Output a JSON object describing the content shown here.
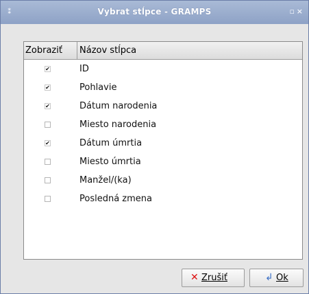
{
  "window": {
    "title": "Vybrat stĺpce - GRAMPS"
  },
  "table": {
    "headers": [
      "Zobraziť",
      "Názov stĺpca"
    ],
    "rows": [
      {
        "label": "ID",
        "checked": true
      },
      {
        "label": "Pohlavie",
        "checked": true
      },
      {
        "label": "Dátum narodenia",
        "checked": true
      },
      {
        "label": "Miesto narodenia",
        "checked": false
      },
      {
        "label": "Dátum úmrtia",
        "checked": true
      },
      {
        "label": "Miesto úmrtia",
        "checked": false
      },
      {
        "label": "Manžel/(ka)",
        "checked": false
      },
      {
        "label": "Posledná zmena",
        "checked": false
      }
    ]
  },
  "buttons": {
    "cancel": "Zrušiť",
    "ok": "Ok"
  },
  "icons": {
    "menu": "window-menu-icon",
    "restore": "restore-icon",
    "close": "close-icon",
    "cancel": "cancel-x-icon",
    "ok": "ok-arrow-icon"
  },
  "colors": {
    "titlebar": "#98abcf",
    "cancel_icon": "#dd1111",
    "ok_icon": "#3a6fc6"
  }
}
